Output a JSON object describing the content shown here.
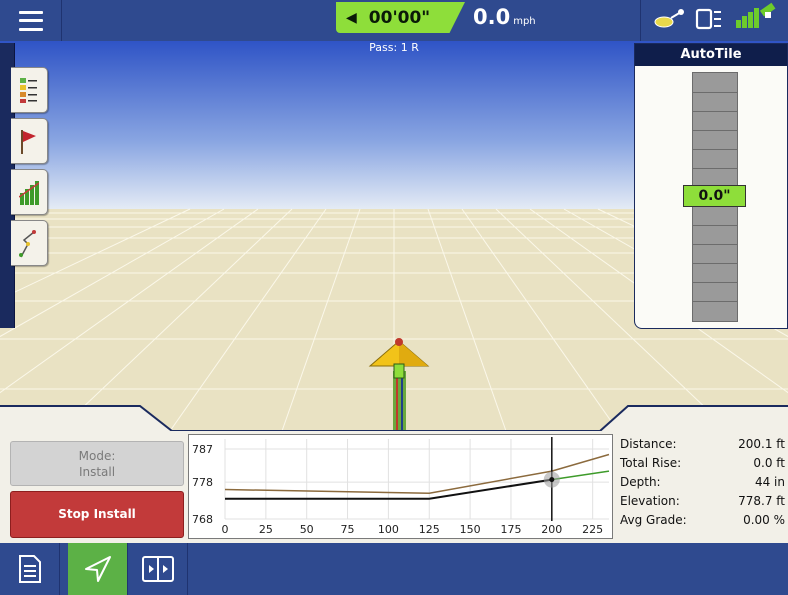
{
  "header": {
    "timer": "00'00\"",
    "speed_value": "0.0",
    "speed_unit": "mph"
  },
  "map": {
    "pass_label": "Pass: 1 R"
  },
  "autotile": {
    "title": "AutoTile",
    "readout": "0.0\""
  },
  "controls": {
    "mode_label": "Mode:",
    "mode_value": "Install",
    "stop_label": "Stop Install"
  },
  "chart_data": {
    "type": "line",
    "ylabel_ticks": [
      "787",
      "778",
      "768"
    ],
    "yticks": [
      787,
      778,
      768
    ],
    "ylim": [
      768,
      787
    ],
    "x_ticks": [
      0,
      25,
      50,
      75,
      100,
      125,
      150,
      175,
      200,
      225
    ],
    "xlim": [
      0,
      235
    ],
    "grid": true,
    "series": [
      {
        "color": "#8b6a3d",
        "x": [
          0,
          125,
          200,
          235
        ],
        "y": [
          776,
          775,
          781,
          785.5
        ]
      },
      {
        "color": "#111111",
        "x": [
          0,
          125,
          200
        ],
        "y": [
          773.5,
          773.5,
          778.7
        ]
      },
      {
        "color": "#3e9b2a",
        "x": [
          200,
          235
        ],
        "y": [
          778.7,
          781
        ]
      }
    ],
    "cursor_x": 200
  },
  "stats": [
    {
      "label": "Distance:",
      "value": "200.1 ft"
    },
    {
      "label": "Total Rise:",
      "value": "0.0 ft"
    },
    {
      "label": "Depth:",
      "value": "44 in"
    },
    {
      "label": "Elevation:",
      "value": "778.7 ft"
    },
    {
      "label": "Avg Grade:",
      "value": "0.00 %"
    }
  ],
  "colors": {
    "accent_green": "#8ede3a",
    "nav_blue": "#2f4a8f",
    "stop_red": "#c23a3a"
  }
}
